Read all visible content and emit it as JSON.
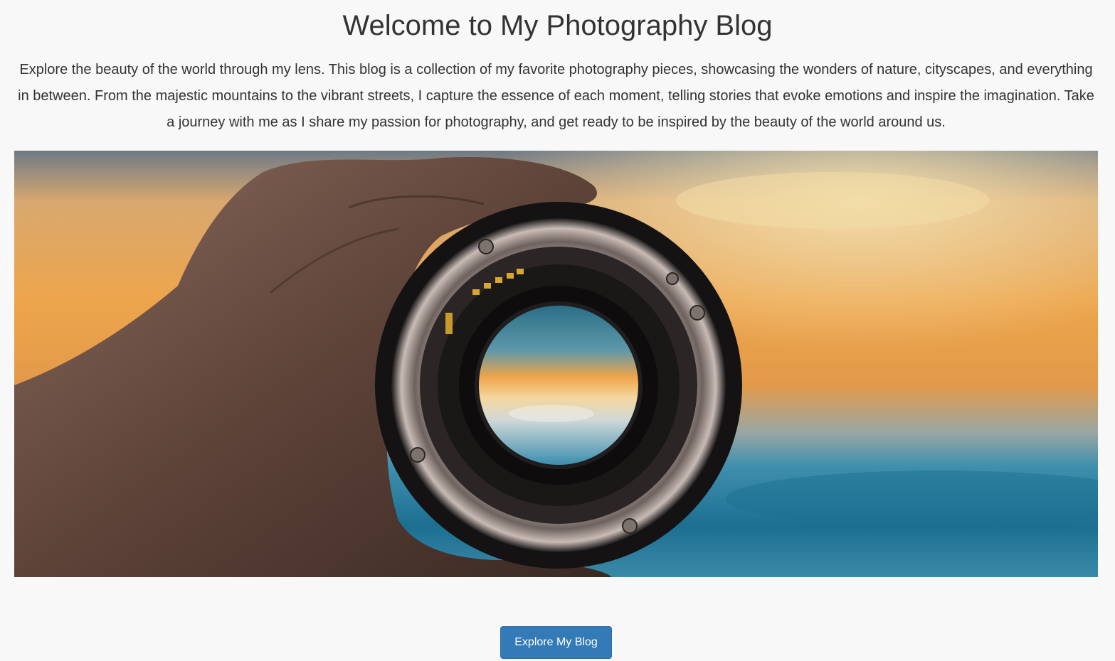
{
  "header": {
    "title": "Welcome to My Photography Blog"
  },
  "intro": {
    "text": "Explore the beauty of the world through my lens. This blog is a collection of my favorite photography pieces, showcasing the wonders of nature, cityscapes, and everything in between. From the majestic mountains to the vibrant streets, I capture the essence of each moment, telling stories that evoke emotions and inspire the imagination. Take a journey with me as I share my passion for photography, and get ready to be inspired by the beauty of the world around us."
  },
  "hero": {
    "image_icon": "camera-lens-photo"
  },
  "cta": {
    "label": "Explore My Blog"
  },
  "colors": {
    "background": "#f8f8f8",
    "text": "#333333",
    "button": "#337ab7",
    "button_text": "#ffffff"
  }
}
